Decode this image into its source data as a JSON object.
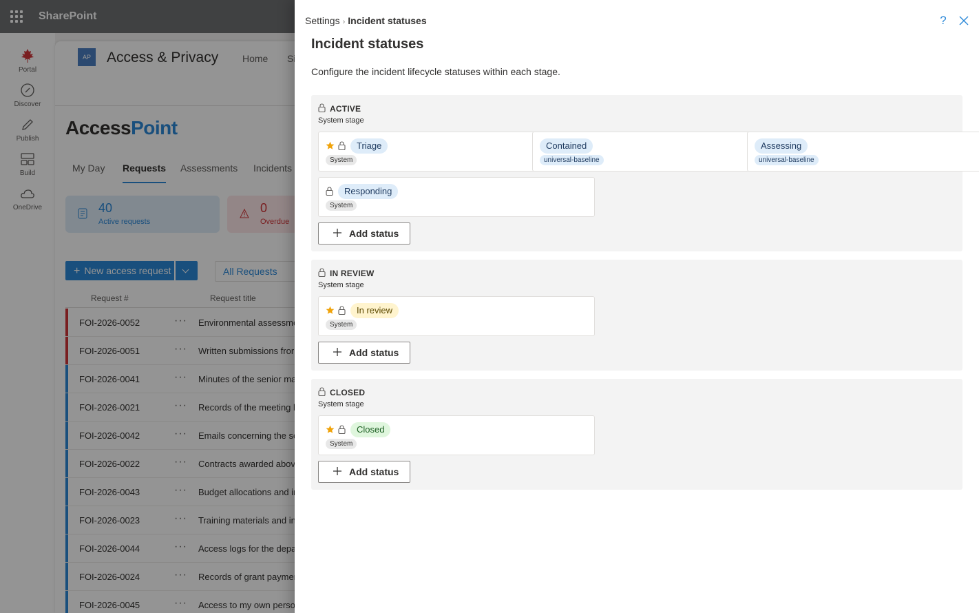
{
  "suite": {
    "title": "SharePoint"
  },
  "rail": [
    {
      "label": "Portal",
      "icon": "maple-leaf-icon"
    },
    {
      "label": "Discover",
      "icon": "compass-icon"
    },
    {
      "label": "Publish",
      "icon": "pencil-icon"
    },
    {
      "label": "Build",
      "icon": "build-icon"
    },
    {
      "label": "OneDrive",
      "icon": "cloud-icon"
    }
  ],
  "site": {
    "logo": "AP",
    "name": "Access & Privacy",
    "nav": [
      "Home",
      "Si"
    ],
    "brand_part1": "Access",
    "brand_part2": "Point",
    "tabs": [
      "My Day",
      "Requests",
      "Assessments",
      "Incidents"
    ],
    "active_tab": "Requests",
    "kpis": [
      {
        "value": "40",
        "label": "Active requests"
      },
      {
        "value": "0",
        "label": "Overdue"
      }
    ],
    "new_button": "New access request",
    "view": "All Requests",
    "columns": [
      "Request #",
      "Request title"
    ],
    "rows": [
      {
        "id": "FOI-2026-0052",
        "title": "Environmental assessme",
        "flag": "#d13438"
      },
      {
        "id": "FOI-2026-0051",
        "title": "Written submissions fror",
        "flag": "#d13438"
      },
      {
        "id": "FOI-2026-0041",
        "title": "Minutes of the senior ma",
        "flag": "#2b88d8"
      },
      {
        "id": "FOI-2026-0021",
        "title": "Records of the meeting b",
        "flag": "#2b88d8"
      },
      {
        "id": "FOI-2026-0042",
        "title": "Emails concerning the se",
        "flag": "#2b88d8"
      },
      {
        "id": "FOI-2026-0022",
        "title": "Contracts awarded abov",
        "flag": "#2b88d8"
      },
      {
        "id": "FOI-2026-0043",
        "title": "Budget allocations and ir",
        "flag": "#2b88d8"
      },
      {
        "id": "FOI-2026-0023",
        "title": "Training materials and in",
        "flag": "#2b88d8"
      },
      {
        "id": "FOI-2026-0044",
        "title": "Access logs for the depa",
        "flag": "#2b88d8"
      },
      {
        "id": "FOI-2026-0024",
        "title": "Records of grant paymer",
        "flag": "#2b88d8"
      },
      {
        "id": "FOI-2026-0045",
        "title": "Access to my own perso",
        "flag": "#2b88d8"
      }
    ]
  },
  "panel": {
    "breadcrumb": [
      "Settings",
      "Incident statuses"
    ],
    "help_label": "?",
    "title": "Incident statuses",
    "description": "Configure the incident lifecycle statuses within each stage.",
    "add_label": "Add status",
    "stages": [
      {
        "name": "ACTIVE",
        "subtitle": "System stage",
        "statuses": [
          {
            "label": "Triage",
            "tag": "System",
            "default": true,
            "locked": true,
            "color": "blue"
          },
          {
            "label": "Contained",
            "tag": "universal-baseline",
            "default": false,
            "locked": false,
            "color": "blue"
          },
          {
            "label": "Assessing",
            "tag": "universal-baseline",
            "default": false,
            "locked": false,
            "color": "blue"
          },
          {
            "label": "Responding",
            "tag": "System",
            "default": false,
            "locked": true,
            "color": "blue"
          }
        ]
      },
      {
        "name": "IN REVIEW",
        "subtitle": "System stage",
        "statuses": [
          {
            "label": "In review",
            "tag": "System",
            "default": true,
            "locked": true,
            "color": "yellow"
          }
        ]
      },
      {
        "name": "CLOSED",
        "subtitle": "System stage",
        "statuses": [
          {
            "label": "Closed",
            "tag": "System",
            "default": true,
            "locked": true,
            "color": "green"
          }
        ]
      }
    ]
  }
}
